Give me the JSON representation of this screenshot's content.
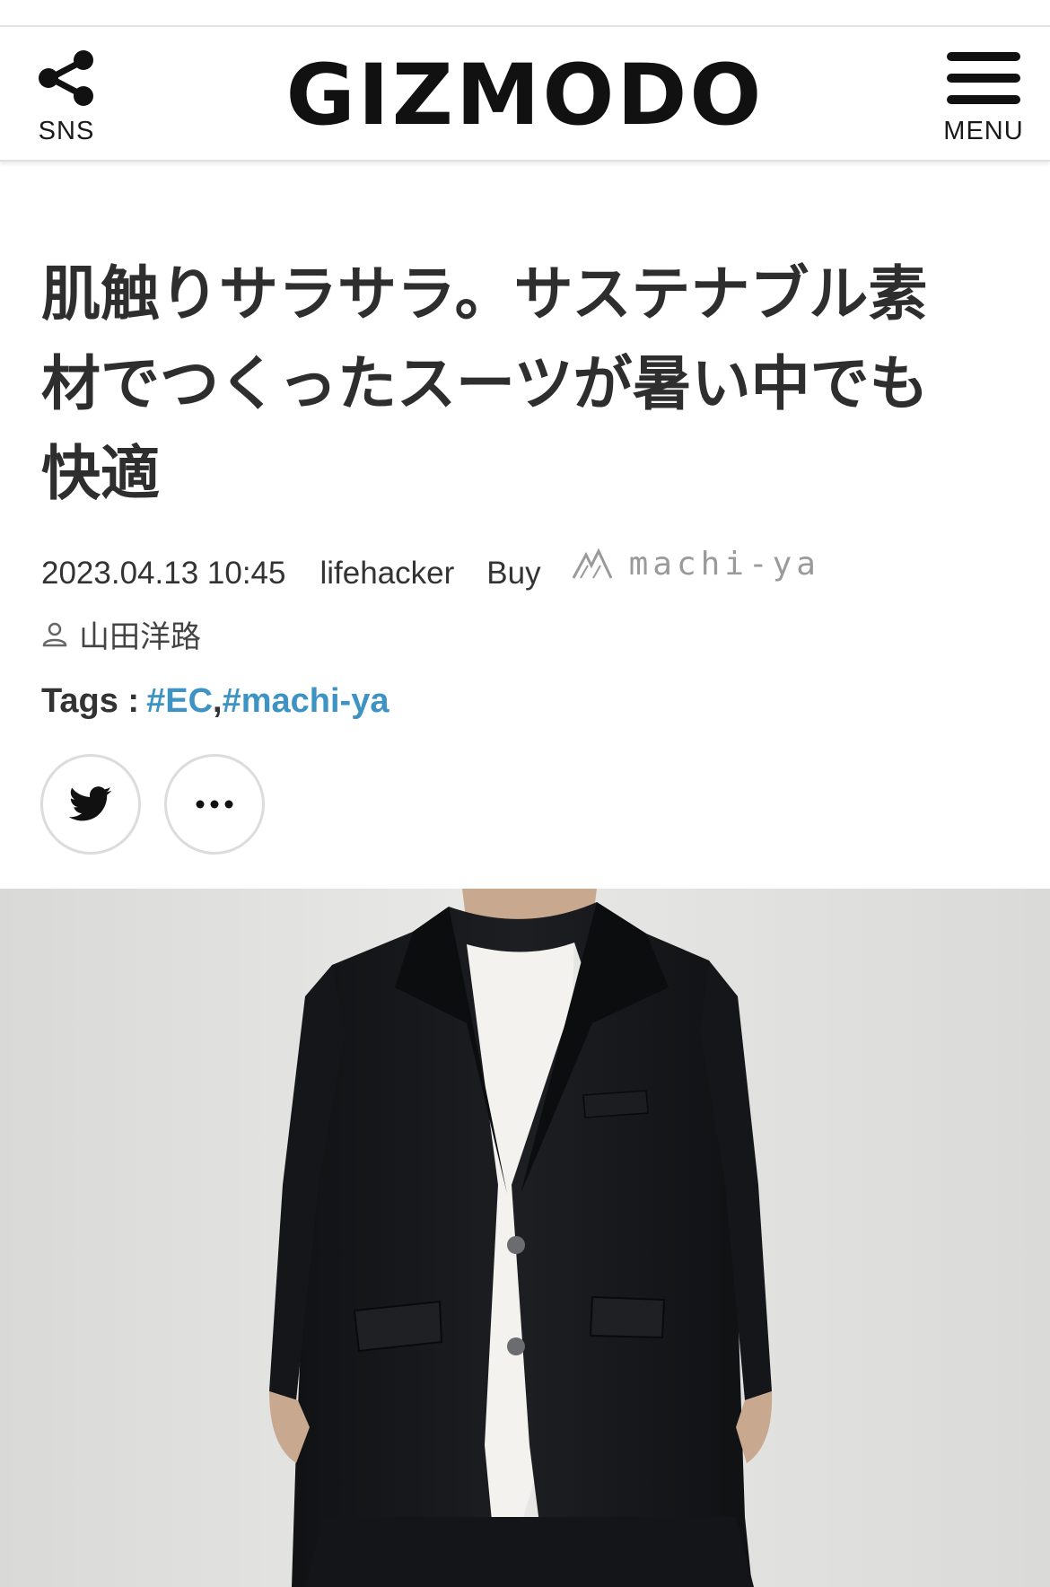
{
  "header": {
    "sns_label": "SNS",
    "logo": "GIZMODO",
    "menu_label": "MENU",
    "share_icon": "share-icon",
    "menu_icon": "hamburger-menu-icon"
  },
  "article": {
    "title_lines": [
      "肌触りサラサラ。サステナブル素",
      "材でつくったスーツが暑い中でも",
      "快適"
    ],
    "date": "2023.04.13 10:45",
    "site": "lifehacker",
    "category": "Buy",
    "partner_logo": "machi-ya",
    "author": "山田洋路",
    "tags_label": "Tags :",
    "tags": [
      "#EC",
      "#machi-ya"
    ],
    "tag_separator": ","
  },
  "share_buttons": {
    "twitter_icon": "twitter-icon",
    "more_icon": "more-horizontal-icon"
  },
  "hero_image": {
    "subject": "suit-jacket-photo"
  },
  "colors": {
    "tag_link": "#3d93c4",
    "title_text": "#2e2e2e",
    "border": "#dcdcdc",
    "jacket": "#17181b"
  }
}
